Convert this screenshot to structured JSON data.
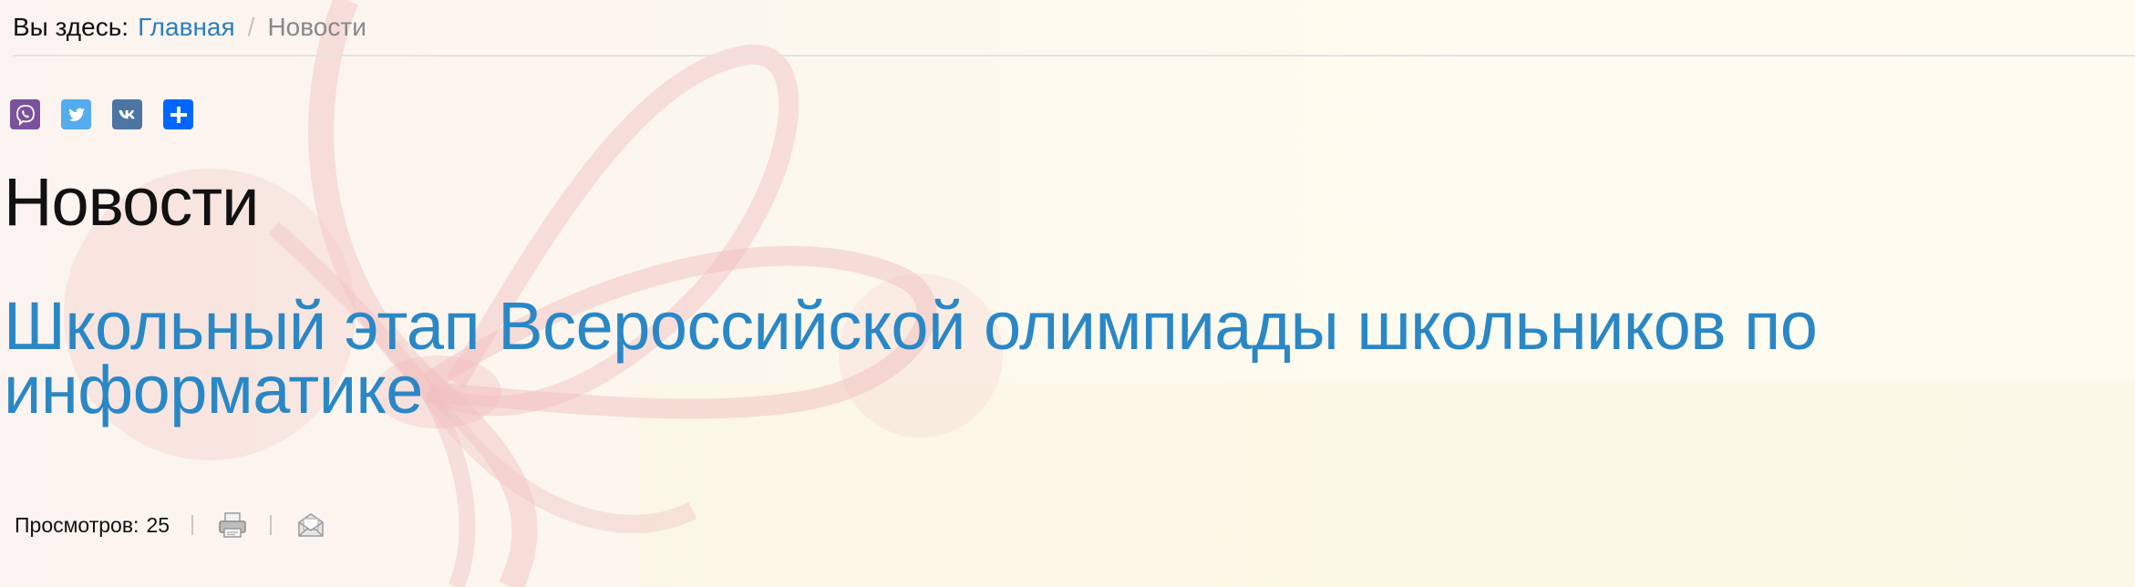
{
  "breadcrumb": {
    "lead": "Вы здесь:",
    "home": "Главная",
    "separator": "/",
    "current": "Новости"
  },
  "share": {
    "buttons": [
      {
        "icon": "viber-icon",
        "color": "#7b519d"
      },
      {
        "icon": "twitter-icon",
        "color": "#55acee"
      },
      {
        "icon": "vk-icon",
        "color": "#4c75a3"
      },
      {
        "icon": "plus-share-icon",
        "color": "#0166ff"
      }
    ]
  },
  "page": {
    "title": "Новости"
  },
  "article": {
    "title": "Школьный этап Всероссийской олимпиады школьников по информатике",
    "views_label": "Просмотров:",
    "views_count": "25",
    "print_icon": "print-icon",
    "email_icon": "email-icon"
  },
  "colors": {
    "link": "#2a87c6",
    "breadcrumb_link": "#2a7fbf",
    "text": "#111111"
  }
}
